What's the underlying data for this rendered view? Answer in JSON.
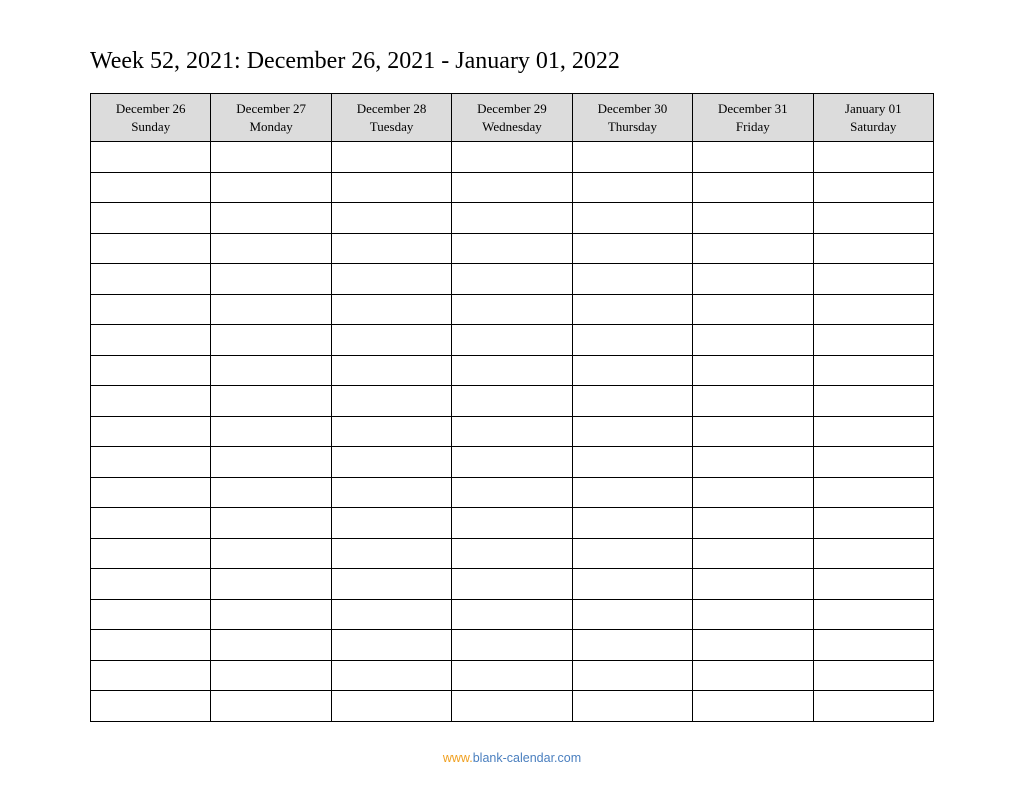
{
  "title": "Week 52, 2021: December 26, 2021 - January 01, 2022",
  "days": [
    {
      "date": "December 26",
      "weekday": "Sunday"
    },
    {
      "date": "December 27",
      "weekday": "Monday"
    },
    {
      "date": "December 28",
      "weekday": "Tuesday"
    },
    {
      "date": "December 29",
      "weekday": "Wednesday"
    },
    {
      "date": "December 30",
      "weekday": "Thursday"
    },
    {
      "date": "December 31",
      "weekday": "Friday"
    },
    {
      "date": "January 01",
      "weekday": "Saturday"
    }
  ],
  "row_count": 19,
  "footer": {
    "prefix": "www.",
    "rest": "blank-calendar.com"
  }
}
